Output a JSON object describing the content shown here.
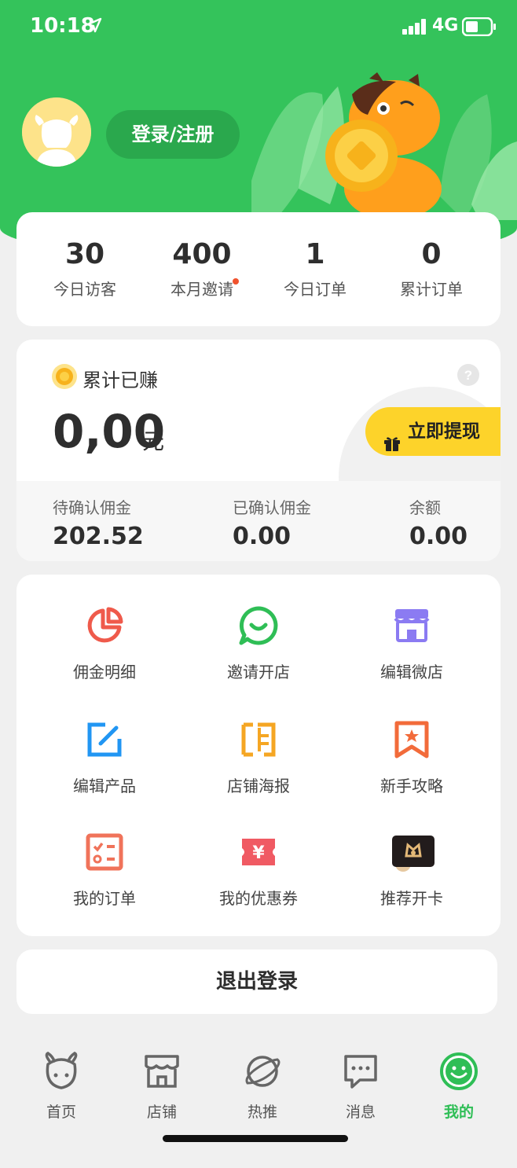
{
  "status_bar": {
    "time": "10:18",
    "network": "4G"
  },
  "header": {
    "login_label": "登录/注册"
  },
  "stats": [
    {
      "value": "30",
      "label": "今日访客"
    },
    {
      "value": "400",
      "label": "本月邀请"
    },
    {
      "value": "1",
      "label": "今日订单"
    },
    {
      "value": "0",
      "label": "累计订单"
    }
  ],
  "earnings": {
    "title": "累计已赚",
    "amount": "0,00",
    "unit": "元",
    "withdraw_label": "立即提现",
    "pending_label": "待确认佣金",
    "pending_value": "202.52",
    "confirmed_label": "已确认佣金",
    "confirmed_value": "0.00",
    "balance_label": "余额",
    "balance_value": "0.00"
  },
  "features": [
    {
      "label": "佣金明细",
      "icon": "pie-chart-icon"
    },
    {
      "label": "邀请开店",
      "icon": "chat-bubble-icon"
    },
    {
      "label": "编辑微店",
      "icon": "store-icon"
    },
    {
      "label": "编辑产品",
      "icon": "edit-icon"
    },
    {
      "label": "店铺海报",
      "icon": "poster-icon"
    },
    {
      "label": "新手攻略",
      "icon": "bookmark-star-icon"
    },
    {
      "label": "我的订单",
      "icon": "checklist-icon"
    },
    {
      "label": "我的优惠券",
      "icon": "coupon-icon"
    },
    {
      "label": "推荐开卡",
      "icon": "card-icon"
    }
  ],
  "logout_label": "退出登录",
  "tabs": [
    {
      "label": "首页",
      "icon": "cow-icon"
    },
    {
      "label": "店铺",
      "icon": "shop-icon"
    },
    {
      "label": "热推",
      "icon": "planet-icon"
    },
    {
      "label": "消息",
      "icon": "message-icon"
    },
    {
      "label": "我的",
      "icon": "smile-icon",
      "active": true
    }
  ],
  "colors": {
    "brand_green": "#34c35b",
    "accent_yellow": "#fdd32a",
    "notice_red": "#f0522e"
  }
}
